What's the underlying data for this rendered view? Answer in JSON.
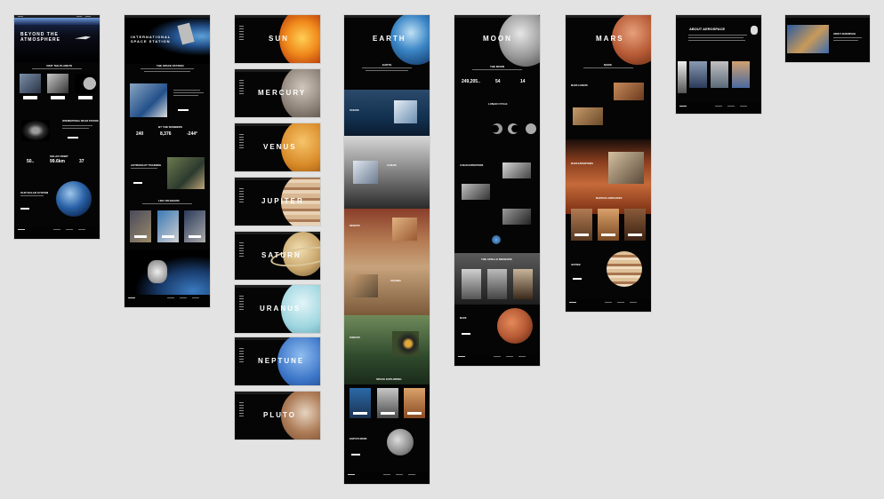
{
  "boards": {
    "home": {
      "title_line1": "BEYOND THE",
      "title_line2": "ATMOSPHERE",
      "section1": "VISIT THE PLANETS",
      "section2": "INTERNATIONAL SPACE STATION",
      "section3": "SOLAR ORBIT",
      "stats": [
        "50..",
        "99.6km",
        "37"
      ],
      "section4": "OUR SOLAR SYSTEM"
    },
    "iss": {
      "title_line1": "INTERNATIONAL",
      "title_line2": "SPACE STATION",
      "section1": "THE SPACE STATION",
      "section2": "BY THE NUMBERS",
      "stats": [
        "240",
        "8,376",
        "-244°"
      ],
      "section3": "ASTRONAUT TRAINING",
      "section4": "LIFE ON BOARD"
    },
    "planets": [
      "SUN",
      "MERCURY",
      "VENUS",
      "JUPITER",
      "SATURN",
      "URANUS",
      "NEPTUNE",
      "PLUTO"
    ],
    "earth": {
      "title": "EARTH",
      "section1": "EARTH",
      "sections": [
        "OCEANS",
        "CLIMATE",
        "DESERTS",
        "SAVANNA",
        "FORESTS"
      ],
      "footer_section": "SPACE EXPLORING",
      "moon_section": "EARTH'S MOON"
    },
    "moon": {
      "title": "MOON",
      "section1": "THE MOON",
      "stats": [
        "249,205..",
        "54",
        "14"
      ],
      "section2": "LUNAR CYCLE",
      "section3": "LUNAR EXPEDITIONS",
      "section4": "THE APOLLO MISSIONS",
      "section5": "MARS"
    },
    "mars": {
      "title": "MARS",
      "section1": "MARS",
      "section2": "MARS CLIMATE",
      "section3": "MARS EXPEDITIONS",
      "section4": "MARTIAN LANDSCAPES",
      "section5": "JUPITER"
    },
    "about": {
      "title": "ABOUT AEROSPACE"
    },
    "mini": {
      "title": "ABOUT AEROSPACE"
    }
  },
  "colors": {
    "canvas": "#e3e3e3",
    "board": "#050505",
    "sun": "#e8661a",
    "mars": "#b65a35",
    "earth_blue": "#2a63a8",
    "jupiter": "#c9a27c"
  }
}
